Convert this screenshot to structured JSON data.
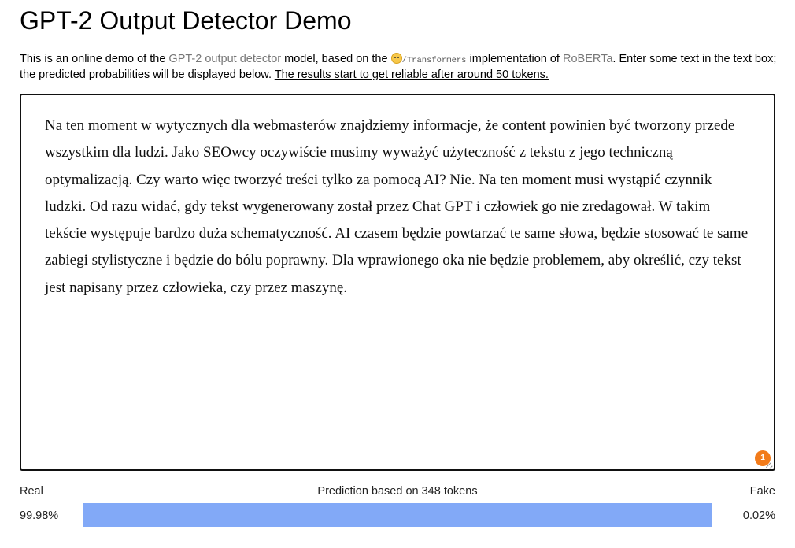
{
  "header": {
    "title": "GPT-2 Output Detector Demo"
  },
  "intro": {
    "part1": "This is an online demo of the ",
    "detector_link": "GPT-2 output detector",
    "part2": " model, based on the ",
    "transformers_label": "/Transformers",
    "part3": " implementation of ",
    "roberta_link": "RoBERTa",
    "part4": ". Enter some text in the text box; the predicted probabilities will be displayed below. ",
    "reliability_note": "The results start to get reliable after around 50 tokens."
  },
  "textbox": {
    "value": "Na ten moment w wytycznych dla webmasterów znajdziemy informacje, że content powinien być tworzony przede wszystkim dla ludzi. Jako SEOwcy oczywiście musimy wyważyć użyteczność z tekstu z jego techniczną optymalizacją. Czy warto więc tworzyć treści tylko za pomocą AI? Nie. Na ten moment musi wystąpić czynnik ludzki. Od razu widać, gdy tekst wygenerowany został przez Chat GPT i człowiek go nie zredagował. W takim tekście występuje bardzo duża schematyczność. AI czasem będzie powtarzać te same słowa, będzie stosować te same zabiegi stylistyczne i będzie do bólu poprawny. Dla wprawionego oka nie będzie problemem, aby określić, czy tekst jest napisany przez człowieka, czy przez maszynę.",
    "badge_count": "1"
  },
  "result": {
    "real_label": "Real",
    "fake_label": "Fake",
    "prediction_text": "Prediction based on 348 tokens",
    "real_pct": "99.98%",
    "fake_pct": "0.02%",
    "real_fraction": 0.9998,
    "colors": {
      "real": "#82a9f7",
      "fake": "#ff8a8a"
    }
  },
  "icons": {
    "hugging_face": "hugging-face-icon"
  }
}
